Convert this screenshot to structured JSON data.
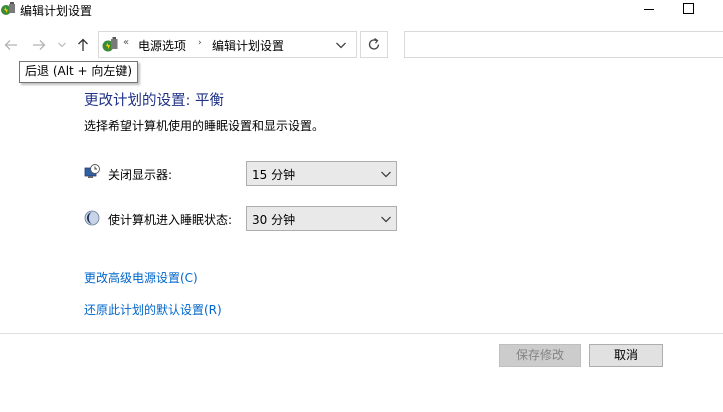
{
  "window": {
    "title": "编辑计划设置",
    "minimize_icon": "minimize-icon",
    "maximize_icon": "maximize-icon"
  },
  "nav": {
    "back_icon": "arrow-left-icon",
    "forward_icon": "arrow-right-icon",
    "recent_icon": "chevron-down-icon",
    "up_icon": "arrow-up-icon",
    "tooltip": "后退 (Alt + 向左键)"
  },
  "address": {
    "location_icon": "power-options-icon",
    "overflow": "«",
    "breadcrumbs": [
      "电源选项",
      "编辑计划设置"
    ],
    "separator": "›",
    "dropdown_icon": "chevron-down-icon",
    "refresh_icon": "refresh-icon",
    "search_placeholder": ""
  },
  "content": {
    "heading": "更改计划的设置: 平衡",
    "subheading": "选择希望计算机使用的睡眠设置和显示设置。",
    "settings": [
      {
        "icon": "display-timer-icon",
        "label": "关闭显示器:",
        "value": "15 分钟"
      },
      {
        "icon": "sleep-moon-icon",
        "label": "使计算机进入睡眠状态:",
        "value": "30 分钟"
      }
    ],
    "links": {
      "advanced": "更改高级电源设置(C)",
      "restore": "还原此计划的默认设置(R)"
    }
  },
  "footer": {
    "save_label": "保存修改",
    "cancel_label": "取消"
  },
  "colors": {
    "heading": "#1e3287",
    "link": "#0066cc",
    "disabled_button": "#cccccc"
  }
}
